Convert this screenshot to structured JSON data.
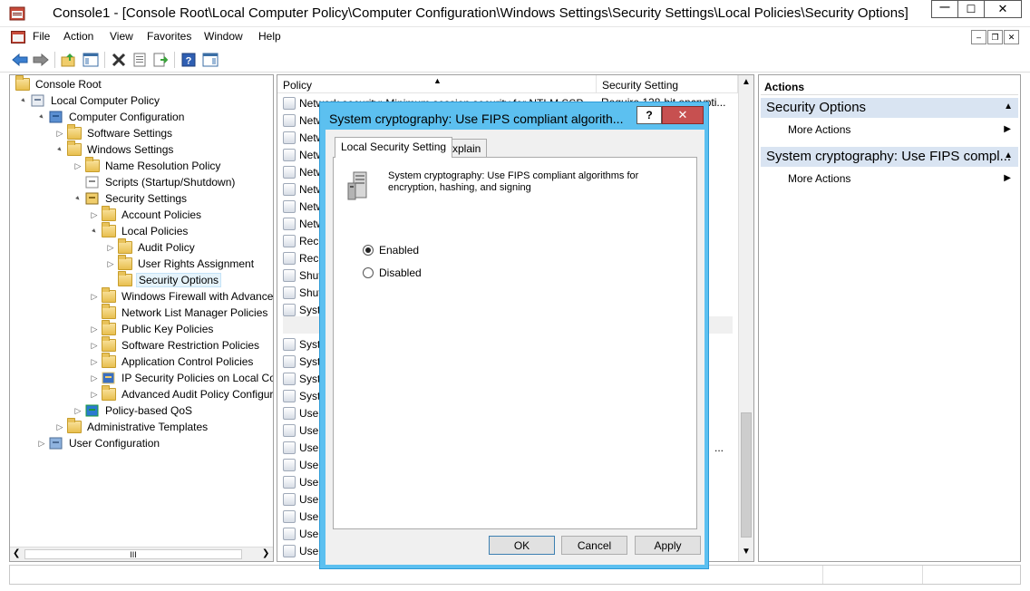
{
  "window": {
    "title": "Console1 - [Console Root\\Local Computer Policy\\Computer Configuration\\Windows Settings\\Security Settings\\Local Policies\\Security Options]",
    "min_symbol": "—",
    "max_symbol": "☐",
    "close_symbol": "✕"
  },
  "menu": {
    "items": [
      "File",
      "Action",
      "View",
      "Favorites",
      "Window",
      "Help"
    ]
  },
  "toolbar": {
    "icons": [
      "back-arrow-icon",
      "forward-arrow-icon",
      "up-folder-icon",
      "show-hide-tree-icon",
      "delete-icon",
      "properties-icon",
      "export-list-icon",
      "help-icon",
      "show-hide-action-pane-icon"
    ]
  },
  "tree": {
    "items": [
      {
        "label": "Console Root",
        "icon": "folder",
        "expand": ""
      },
      {
        "label": "Local Computer Policy",
        "icon": "policy-doc",
        "expand": "▲"
      },
      {
        "label": "Computer Configuration",
        "icon": "computer",
        "expand": "▲"
      },
      {
        "label": "Software Settings",
        "icon": "folder",
        "expand": "▷"
      },
      {
        "label": "Windows Settings",
        "icon": "folder",
        "expand": "▲"
      },
      {
        "label": "Name Resolution Policy",
        "icon": "folder",
        "expand": "▷"
      },
      {
        "label": "Scripts (Startup/Shutdown)",
        "icon": "doc",
        "expand": ""
      },
      {
        "label": "Security Settings",
        "icon": "security",
        "expand": "▲"
      },
      {
        "label": "Account Policies",
        "icon": "folder",
        "expand": "▷"
      },
      {
        "label": "Local Policies",
        "icon": "folder",
        "expand": "▲"
      },
      {
        "label": "Audit Policy",
        "icon": "folder",
        "expand": "▷"
      },
      {
        "label": "User Rights Assignment",
        "icon": "folder",
        "expand": "▷"
      },
      {
        "label": "Security Options",
        "icon": "folder",
        "expand": ""
      },
      {
        "label": "Windows Firewall with Advanced",
        "icon": "folder",
        "expand": "▷"
      },
      {
        "label": "Network List Manager Policies",
        "icon": "folder",
        "expand": ""
      },
      {
        "label": "Public Key Policies",
        "icon": "folder",
        "expand": "▷"
      },
      {
        "label": "Software Restriction Policies",
        "icon": "folder",
        "expand": "▷"
      },
      {
        "label": "Application Control Policies",
        "icon": "folder",
        "expand": "▷"
      },
      {
        "label": "IP Security Policies on Local Cor",
        "icon": "ipsec",
        "expand": "▷"
      },
      {
        "label": "Advanced Audit Policy Configur",
        "icon": "folder",
        "expand": "▷"
      },
      {
        "label": "Policy-based QoS",
        "icon": "chart",
        "expand": "▷"
      },
      {
        "label": "Administrative Templates",
        "icon": "folder",
        "expand": "▷"
      },
      {
        "label": "User Configuration",
        "icon": "user",
        "expand": "▷"
      }
    ],
    "scroll_thumb_label": "III"
  },
  "list": {
    "col_policy": "Policy",
    "col_setting": "Security Setting",
    "first_row_policy": "Network security: Minimum session security for NTLM SSP",
    "first_row_setting": "Require 128-bit encrypti...",
    "rows": [
      "Netw",
      "Netw",
      "Netw",
      "Netw",
      "Netw",
      "Netw",
      "Netw",
      "Reco",
      "Reco",
      "Shut",
      "Shut",
      "Syste",
      "Syste",
      "Syste",
      "Syste",
      "Syste",
      "Syste",
      "User",
      "User",
      "User",
      "User",
      "User",
      "User",
      "User",
      "User",
      "User"
    ],
    "ellipsis_text": "..."
  },
  "actions": {
    "title": "Actions",
    "groups": [
      {
        "header": "Security Options",
        "item": "More Actions"
      },
      {
        "header": "System cryptography: Use FIPS compl...",
        "item": "More Actions"
      }
    ]
  },
  "dialog": {
    "title": "System cryptography: Use FIPS compliant algorith...",
    "help_label": "?",
    "close_label": "✕",
    "tabs": [
      "Local Security Setting",
      "Explain"
    ],
    "description_line1": "System cryptography: Use FIPS compliant algorithms for",
    "description_line2": "encryption, hashing, and signing",
    "options": [
      {
        "label": "Enabled",
        "checked": true
      },
      {
        "label": "Disabled",
        "checked": false
      }
    ],
    "buttons": [
      "OK",
      "Cancel",
      "Apply"
    ]
  }
}
